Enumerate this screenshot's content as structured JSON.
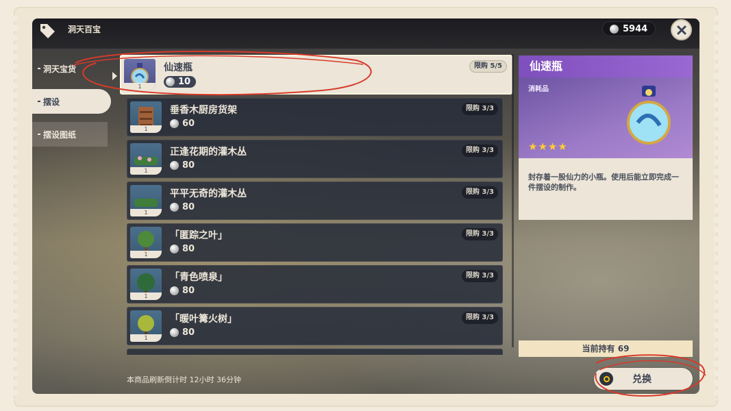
{
  "header": {
    "shop_title": "洞天百宝",
    "currency_amount": "5944"
  },
  "sidebar": {
    "items": [
      {
        "label": "洞天宝货"
      },
      {
        "label": "摆设"
      },
      {
        "label": "摆设图纸"
      }
    ]
  },
  "items": [
    {
      "name": "仙速瓶",
      "price": "10",
      "limit": "限购 5/5",
      "qty": "1",
      "icon": "potion-icon"
    },
    {
      "name": "垂香木厨房货架",
      "price": "60",
      "limit": "限购 3/3",
      "qty": "1",
      "icon": "shelf-icon"
    },
    {
      "name": "正逢花期的灌木丛",
      "price": "80",
      "limit": "限购 3/3",
      "qty": "1",
      "icon": "bush-icon"
    },
    {
      "name": "平平无奇的灌木丛",
      "price": "80",
      "limit": "限购 3/3",
      "qty": "1",
      "icon": "bush-icon"
    },
    {
      "name": "「匿踪之叶」",
      "price": "80",
      "limit": "限购 3/3",
      "qty": "1",
      "icon": "tree-icon"
    },
    {
      "name": "「青色喷泉」",
      "price": "80",
      "limit": "限购 3/3",
      "qty": "1",
      "icon": "tree-icon"
    },
    {
      "name": "「暖叶篝火树」",
      "price": "80",
      "limit": "限购 3/3",
      "qty": "1",
      "icon": "tree-icon"
    }
  ],
  "detail": {
    "name": "仙速瓶",
    "type": "消耗品",
    "stars": "★★★★",
    "description": "封存着一股仙力的小瓶。使用后能立即完成一件摆设的制作。",
    "owned": "当前持有 69"
  },
  "footer": {
    "refresh_text": "本商品刷新倒计时 12小时 36分钟",
    "exchange_label": "兑换"
  },
  "colors": {
    "accent_purple": "#9a68d1",
    "panel_beige": "#ece5d8",
    "row_dark": "#282d3a",
    "annotation_red": "#d83a2a"
  }
}
